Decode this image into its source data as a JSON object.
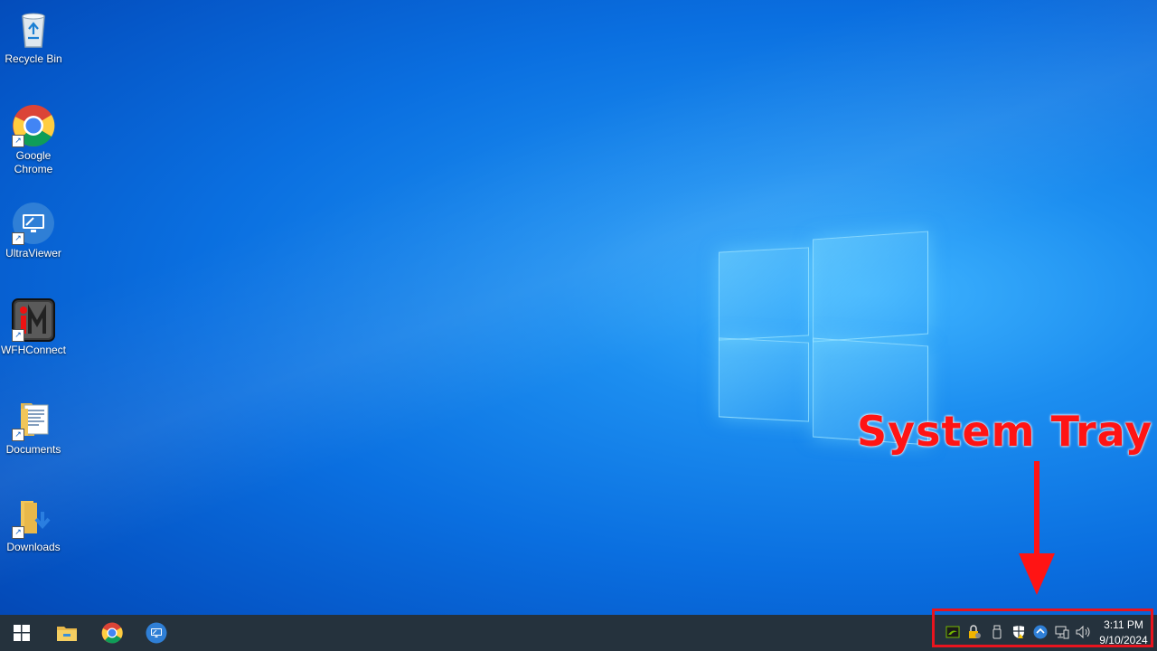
{
  "desktop": {
    "icons": [
      {
        "label": "Recycle Bin",
        "icon": "recycle-bin-icon"
      },
      {
        "label": "Google Chrome",
        "icon": "chrome-icon"
      },
      {
        "label": "UltraViewer",
        "icon": "ultraviewer-icon"
      },
      {
        "label": "WFHConnect",
        "icon": "wfhconnect-icon"
      },
      {
        "label": "Documents",
        "icon": "documents-folder-icon"
      },
      {
        "label": "Downloads",
        "icon": "downloads-folder-icon"
      }
    ]
  },
  "annotation": {
    "label": "System Tray",
    "color": "#ff1414"
  },
  "taskbar": {
    "background": "#25323d",
    "pinned": [
      {
        "icon": "windows-start-icon"
      },
      {
        "icon": "file-explorer-icon"
      },
      {
        "icon": "chrome-icon"
      },
      {
        "icon": "ultraviewer-icon"
      }
    ],
    "tray": {
      "icons": [
        "nvidia-icon",
        "vpn-lock-icon",
        "usb-drive-icon",
        "security-warning-icon",
        "ultraviewer-tray-icon",
        "network-icon",
        "volume-icon"
      ],
      "time": "3:11 PM",
      "date": "9/10/2024"
    }
  }
}
